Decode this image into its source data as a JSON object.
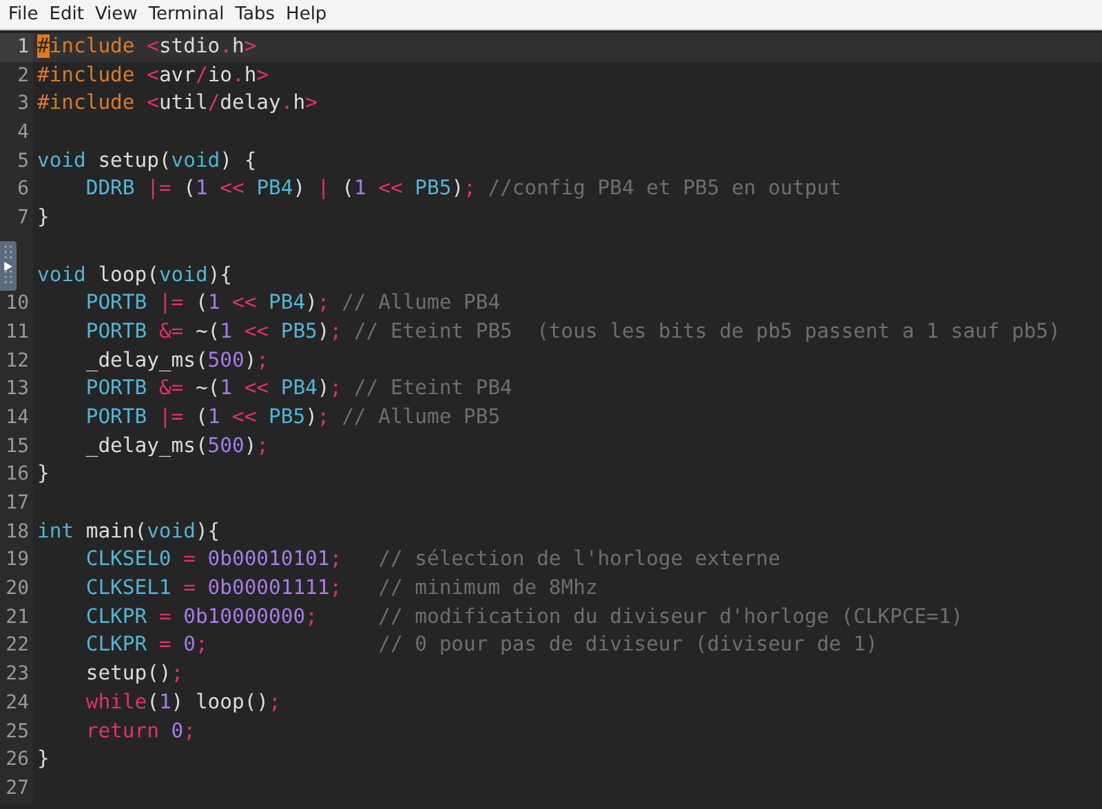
{
  "menu": [
    "File",
    "Edit",
    "View",
    "Terminal",
    "Tabs",
    "Help"
  ],
  "lines": [
    {
      "number": "1",
      "current": true,
      "tokens": [
        {
          "kind": "cursor",
          "text": "#"
        },
        {
          "kind": "preproc",
          "text": "include "
        },
        {
          "kind": "op",
          "text": "<"
        },
        {
          "kind": "text",
          "text": "stdio"
        },
        {
          "kind": "op",
          "text": "."
        },
        {
          "kind": "text",
          "text": "h"
        },
        {
          "kind": "op",
          "text": ">"
        }
      ]
    },
    {
      "number": "2",
      "current": false,
      "tokens": [
        {
          "kind": "preproc",
          "text": "#include "
        },
        {
          "kind": "op",
          "text": "<"
        },
        {
          "kind": "text",
          "text": "avr"
        },
        {
          "kind": "op",
          "text": "/"
        },
        {
          "kind": "text",
          "text": "io"
        },
        {
          "kind": "op",
          "text": "."
        },
        {
          "kind": "text",
          "text": "h"
        },
        {
          "kind": "op",
          "text": ">"
        }
      ]
    },
    {
      "number": "3",
      "current": false,
      "tokens": [
        {
          "kind": "preproc",
          "text": "#include "
        },
        {
          "kind": "op",
          "text": "<"
        },
        {
          "kind": "text",
          "text": "util"
        },
        {
          "kind": "op",
          "text": "/"
        },
        {
          "kind": "text",
          "text": "delay"
        },
        {
          "kind": "op",
          "text": "."
        },
        {
          "kind": "text",
          "text": "h"
        },
        {
          "kind": "op",
          "text": ">"
        }
      ]
    },
    {
      "number": "4",
      "current": false
    },
    {
      "number": "5",
      "current": false,
      "tokens": [
        {
          "kind": "type",
          "text": "void"
        },
        {
          "kind": "text",
          "text": " setup("
        },
        {
          "kind": "type",
          "text": "void"
        },
        {
          "kind": "text",
          "text": ") {"
        }
      ]
    },
    {
      "number": "6",
      "current": false,
      "tokens": [
        {
          "kind": "type",
          "text": "    DDRB "
        },
        {
          "kind": "op",
          "text": "|="
        },
        {
          "kind": "text",
          "text": " ("
        },
        {
          "kind": "num",
          "text": "1"
        },
        {
          "kind": "op",
          "text": " << "
        },
        {
          "kind": "type",
          "text": "PB4"
        },
        {
          "kind": "text",
          "text": ") "
        },
        {
          "kind": "op",
          "text": "|"
        },
        {
          "kind": "text",
          "text": " ("
        },
        {
          "kind": "num",
          "text": "1"
        },
        {
          "kind": "op",
          "text": " << "
        },
        {
          "kind": "type",
          "text": "PB5"
        },
        {
          "kind": "text",
          "text": ")"
        },
        {
          "kind": "op",
          "text": ";"
        },
        {
          "kind": "comment",
          "text": " //config PB4 et PB5 en output"
        }
      ]
    },
    {
      "number": "7",
      "current": false,
      "tokens": [
        {
          "kind": "text",
          "text": "}"
        }
      ]
    },
    {
      "current": false
    },
    {
      "current": false,
      "tokens": [
        {
          "kind": "type",
          "text": "void"
        },
        {
          "kind": "text",
          "text": " loop("
        },
        {
          "kind": "type",
          "text": "void"
        },
        {
          "kind": "text",
          "text": "){"
        }
      ]
    },
    {
      "number": "10",
      "current": false,
      "tokens": [
        {
          "kind": "type",
          "text": "    PORTB "
        },
        {
          "kind": "op",
          "text": "|="
        },
        {
          "kind": "text",
          "text": " ("
        },
        {
          "kind": "num",
          "text": "1"
        },
        {
          "kind": "op",
          "text": " << "
        },
        {
          "kind": "type",
          "text": "PB4"
        },
        {
          "kind": "text",
          "text": ")"
        },
        {
          "kind": "op",
          "text": ";"
        },
        {
          "kind": "comment",
          "text": " // Allume PB4"
        }
      ]
    },
    {
      "number": "11",
      "current": false,
      "tokens": [
        {
          "kind": "type",
          "text": "    PORTB "
        },
        {
          "kind": "op",
          "text": "&="
        },
        {
          "kind": "text",
          "text": " ~("
        },
        {
          "kind": "num",
          "text": "1"
        },
        {
          "kind": "op",
          "text": " << "
        },
        {
          "kind": "type",
          "text": "PB5"
        },
        {
          "kind": "text",
          "text": ")"
        },
        {
          "kind": "op",
          "text": ";"
        },
        {
          "kind": "comment",
          "text": " // Eteint PB5  (tous les bits de pb5 passent a 1 sauf pb5)"
        }
      ]
    },
    {
      "number": "12",
      "current": false,
      "tokens": [
        {
          "kind": "text",
          "text": "    _delay_ms("
        },
        {
          "kind": "num",
          "text": "500"
        },
        {
          "kind": "text",
          "text": ")"
        },
        {
          "kind": "op",
          "text": ";"
        }
      ]
    },
    {
      "number": "13",
      "current": false,
      "tokens": [
        {
          "kind": "type",
          "text": "    PORTB "
        },
        {
          "kind": "op",
          "text": "&="
        },
        {
          "kind": "text",
          "text": " ~("
        },
        {
          "kind": "num",
          "text": "1"
        },
        {
          "kind": "op",
          "text": " << "
        },
        {
          "kind": "type",
          "text": "PB4"
        },
        {
          "kind": "text",
          "text": ")"
        },
        {
          "kind": "op",
          "text": ";"
        },
        {
          "kind": "comment",
          "text": " // Eteint PB4"
        }
      ]
    },
    {
      "number": "14",
      "current": false,
      "tokens": [
        {
          "kind": "type",
          "text": "    PORTB "
        },
        {
          "kind": "op",
          "text": "|="
        },
        {
          "kind": "text",
          "text": " ("
        },
        {
          "kind": "num",
          "text": "1"
        },
        {
          "kind": "op",
          "text": " << "
        },
        {
          "kind": "type",
          "text": "PB5"
        },
        {
          "kind": "text",
          "text": ")"
        },
        {
          "kind": "op",
          "text": ";"
        },
        {
          "kind": "comment",
          "text": " // Allume PB5"
        }
      ]
    },
    {
      "number": "15",
      "current": false,
      "tokens": [
        {
          "kind": "text",
          "text": "    _delay_ms("
        },
        {
          "kind": "num",
          "text": "500"
        },
        {
          "kind": "text",
          "text": ")"
        },
        {
          "kind": "op",
          "text": ";"
        }
      ]
    },
    {
      "number": "16",
      "current": false,
      "tokens": [
        {
          "kind": "text",
          "text": "}"
        }
      ]
    },
    {
      "number": "17",
      "current": false
    },
    {
      "number": "18",
      "current": false,
      "tokens": [
        {
          "kind": "type",
          "text": "int"
        },
        {
          "kind": "text",
          "text": " main("
        },
        {
          "kind": "type",
          "text": "void"
        },
        {
          "kind": "text",
          "text": "){"
        }
      ]
    },
    {
      "number": "19",
      "current": false,
      "tokens": [
        {
          "kind": "type",
          "text": "    CLKSEL0 "
        },
        {
          "kind": "op",
          "text": "="
        },
        {
          "kind": "num",
          "text": " 0b00010101"
        },
        {
          "kind": "op",
          "text": ";"
        },
        {
          "kind": "comment",
          "text": "   // sélection de l'horloge externe"
        }
      ]
    },
    {
      "number": "20",
      "current": false,
      "tokens": [
        {
          "kind": "type",
          "text": "    CLKSEL1 "
        },
        {
          "kind": "op",
          "text": "="
        },
        {
          "kind": "num",
          "text": " 0b00001111"
        },
        {
          "kind": "op",
          "text": ";"
        },
        {
          "kind": "comment",
          "text": "   // minimum de 8Mhz"
        }
      ]
    },
    {
      "number": "21",
      "current": false,
      "tokens": [
        {
          "kind": "type",
          "text": "    CLKPR "
        },
        {
          "kind": "op",
          "text": "="
        },
        {
          "kind": "num",
          "text": " 0b10000000"
        },
        {
          "kind": "op",
          "text": ";"
        },
        {
          "kind": "comment",
          "text": "     // modification du diviseur d'horloge (CLKPCE=1)"
        }
      ]
    },
    {
      "number": "22",
      "current": false,
      "tokens": [
        {
          "kind": "type",
          "text": "    CLKPR "
        },
        {
          "kind": "op",
          "text": "="
        },
        {
          "kind": "num",
          "text": " 0"
        },
        {
          "kind": "op",
          "text": ";"
        },
        {
          "kind": "comment",
          "text": "              // 0 pour pas de diviseur (diviseur de 1)"
        }
      ]
    },
    {
      "number": "23",
      "current": false,
      "tokens": [
        {
          "kind": "text",
          "text": "    setup()"
        },
        {
          "kind": "op",
          "text": ";"
        }
      ]
    },
    {
      "number": "24",
      "current": false,
      "tokens": [
        {
          "kind": "keyword",
          "text": "    while"
        },
        {
          "kind": "text",
          "text": "("
        },
        {
          "kind": "num",
          "text": "1"
        },
        {
          "kind": "text",
          "text": ") loop()"
        },
        {
          "kind": "op",
          "text": ";"
        }
      ]
    },
    {
      "number": "25",
      "current": false,
      "tokens": [
        {
          "kind": "keyword",
          "text": "    return"
        },
        {
          "kind": "num",
          "text": " 0"
        },
        {
          "kind": "op",
          "text": ";"
        }
      ]
    },
    {
      "number": "26",
      "current": false,
      "tokens": [
        {
          "kind": "text",
          "text": "}"
        }
      ]
    },
    {
      "number": "27",
      "current": false
    }
  ]
}
